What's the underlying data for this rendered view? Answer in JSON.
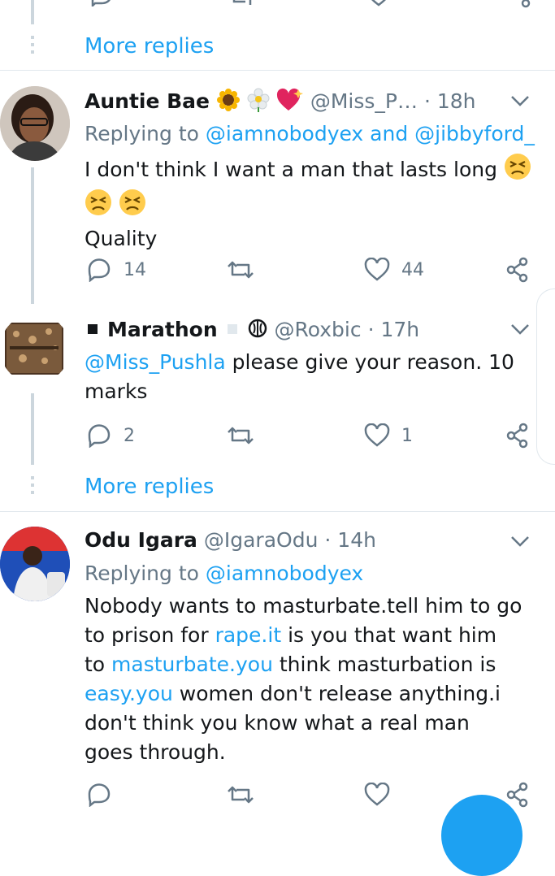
{
  "more_replies_1": "More replies",
  "more_replies_2": "More replies",
  "tweets": [
    {
      "name": "Auntie Bae",
      "handle": "@Miss_P…",
      "time": "· 18h",
      "replying_prefix": "Replying to",
      "replying_users": "@iamnobodyex and @jibbyford_",
      "text_line1": "I don't think I want a man that lasts long",
      "text_line3": "Quality",
      "reply_count": "14",
      "retweet_count": "",
      "like_count": "44"
    },
    {
      "name": "Marathon",
      "handle": "@Roxbic",
      "time": "· 17h",
      "mention": "@Miss_Pushla",
      "text_after_mention": " please give your reason. 10",
      "text_line2": "marks",
      "reply_count": "2",
      "like_count": "1"
    },
    {
      "name": "Odu Igara",
      "handle": "@IgaraOdu",
      "time": "· 14h",
      "replying_prefix": "Replying to",
      "replying_users": "@iamnobodyex",
      "body": {
        "p1": "Nobody wants to masturbate.tell him to go to prison for ",
        "l1": "rape.it",
        "p2": " is you that want him to ",
        "l2": "masturbate.you",
        "p3": " think masturbation is ",
        "l3": "easy.you",
        "p4": " women don't release anything.i don't think you know what a real man goes through."
      }
    }
  ],
  "colors": {
    "accent": "#1da1f2",
    "secondary_text": "#657786",
    "divider": "#e1e8ed",
    "thread_line": "#ccd6dd"
  }
}
